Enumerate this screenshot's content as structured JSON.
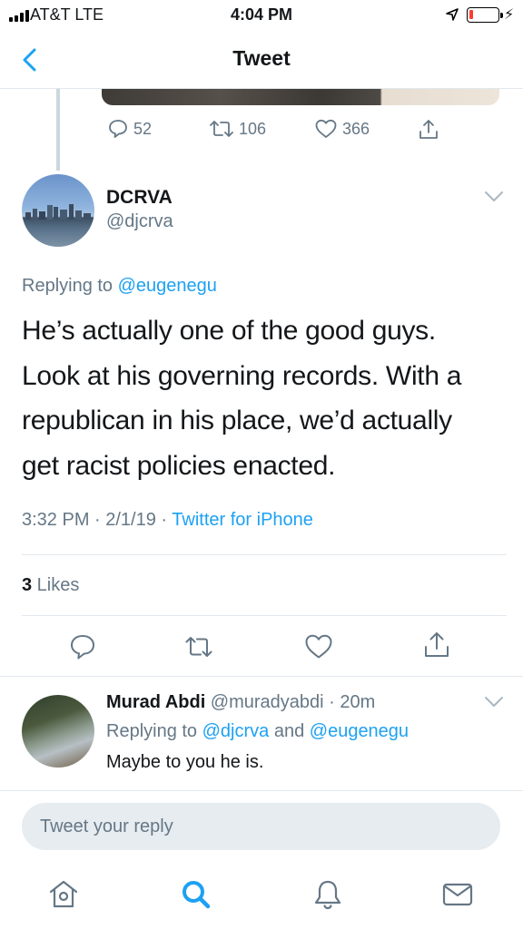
{
  "status_bar": {
    "carrier": "AT&T  LTE",
    "time": "4:04 PM",
    "battery_level": 0.12,
    "icons": [
      "signal-bars-icon",
      "location-arrow-icon",
      "battery-icon",
      "charging-bolt-icon"
    ]
  },
  "nav": {
    "title": "Tweet",
    "back_icon": "chevron-left-icon"
  },
  "previous_tweet": {
    "replies": "52",
    "retweets": "106",
    "likes": "366"
  },
  "tweet": {
    "author_name": "DCRVA",
    "author_handle": "@djcrva",
    "replying_prefix": "Replying to ",
    "replying_to": "@eugenegu",
    "text_lines": [
      "He’s actually one of the good guys.",
      "Look at his governing records. With a",
      "republican in his place, we’d actually",
      "get racist policies enacted."
    ],
    "timestamp": "3:32 PM · 2/1/19 · ",
    "source": "Twitter for iPhone",
    "likes_count": "3",
    "likes_label": " Likes"
  },
  "reply": {
    "author_name": "Murad Abdi",
    "author_handle": " @muradyabdi",
    "time": " · 20m",
    "replying_prefix": "Replying to ",
    "replying_to_1": "@djcrva",
    "replying_and": " and ",
    "replying_to_2": "@eugenegu",
    "text": "Maybe to you he is."
  },
  "composer": {
    "placeholder": "Tweet your reply"
  },
  "tabs": [
    "home-icon",
    "search-icon",
    "notifications-icon",
    "messages-icon"
  ],
  "colors": {
    "accent": "#1da1f2",
    "secondary_text": "#657786",
    "divider": "#e1e8ed"
  }
}
